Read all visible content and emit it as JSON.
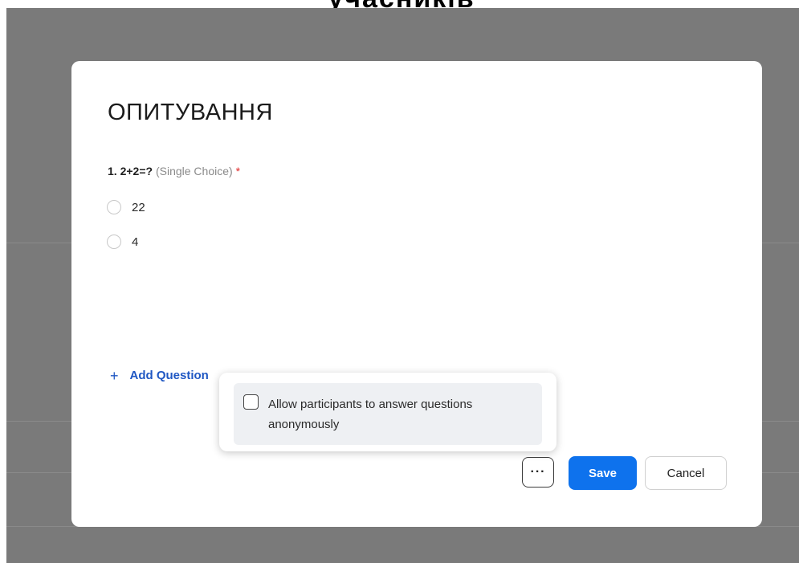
{
  "header": {
    "cut_title": "учасників"
  },
  "modal": {
    "title": "ОПИТУВАННЯ",
    "question": {
      "number": "1.",
      "text": "2+2=?",
      "type": "(Single Choice)",
      "required_mark": "*"
    },
    "options": [
      {
        "label": "22",
        "selected": false
      },
      {
        "label": "4",
        "selected": false
      }
    ],
    "add_question": {
      "icon": "plus-icon",
      "label": "Add Question"
    },
    "popover": {
      "checkbox_label": "Allow participants to answer questions anonymously",
      "checked": false
    },
    "buttons": {
      "more_label": "···",
      "save_label": "Save",
      "cancel_label": "Cancel"
    }
  },
  "colors": {
    "primary": "#0e72ed",
    "link": "#1f57c3",
    "required": "#e02828",
    "overlay": "#7a7a7a"
  }
}
